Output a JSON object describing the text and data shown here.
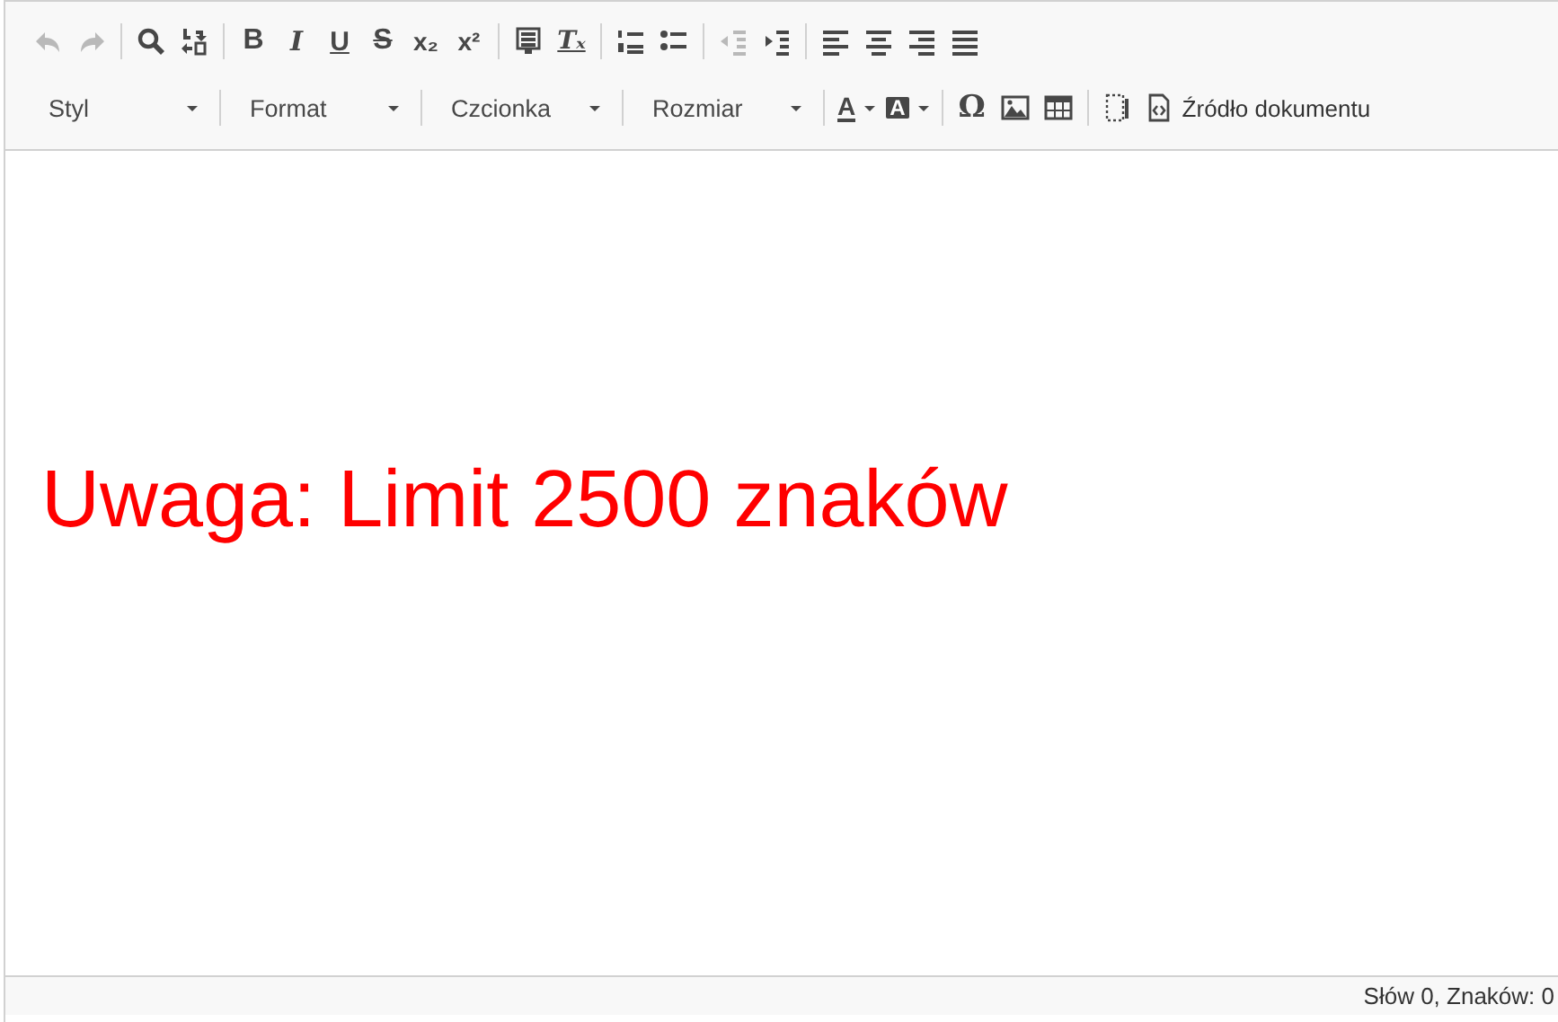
{
  "toolbar": {
    "rows": [
      [
        [
          {
            "kind": "undo",
            "disabled": true
          },
          {
            "kind": "redo",
            "disabled": true
          }
        ],
        [
          {
            "kind": "find",
            "disabled": false
          },
          {
            "kind": "replace",
            "disabled": false
          }
        ],
        [
          {
            "kind": "bold",
            "glyph": "B",
            "disabled": false
          },
          {
            "kind": "italic",
            "glyph": "I",
            "disabled": false
          },
          {
            "kind": "underline",
            "glyph": "U",
            "disabled": false
          },
          {
            "kind": "strike",
            "glyph": "S",
            "disabled": false
          },
          {
            "kind": "subscript",
            "glyph": "x₂",
            "disabled": false
          },
          {
            "kind": "superscript",
            "glyph": "x²",
            "disabled": false
          }
        ],
        [
          {
            "kind": "paste-text",
            "disabled": false
          },
          {
            "kind": "remove-format",
            "glyph": "Tₓ",
            "disabled": false
          }
        ],
        [
          {
            "kind": "numbered-list",
            "disabled": false
          },
          {
            "kind": "bulleted-list",
            "disabled": false
          }
        ],
        [
          {
            "kind": "outdent",
            "disabled": true
          },
          {
            "kind": "indent",
            "disabled": false
          }
        ],
        [
          {
            "kind": "align-left",
            "disabled": false
          },
          {
            "kind": "align-center",
            "disabled": false
          },
          {
            "kind": "align-right",
            "disabled": false
          },
          {
            "kind": "justify",
            "disabled": false
          }
        ]
      ],
      [
        [
          {
            "kind": "combo",
            "label": "Styl"
          }
        ],
        [
          {
            "kind": "combo",
            "label": "Format"
          }
        ],
        [
          {
            "kind": "combo",
            "label": "Czcionka"
          }
        ],
        [
          {
            "kind": "combo",
            "label": "Rozmiar"
          }
        ],
        [
          {
            "kind": "text-color",
            "glyph": "A",
            "disabled": false
          },
          {
            "kind": "bg-color",
            "glyph": "A",
            "disabled": false
          }
        ],
        [
          {
            "kind": "special-char",
            "glyph": "Ω",
            "disabled": false
          },
          {
            "kind": "image",
            "disabled": false
          },
          {
            "kind": "table",
            "disabled": false
          }
        ],
        [
          {
            "kind": "show-blocks",
            "disabled": false
          },
          {
            "kind": "source",
            "label": "Źródło dokumentu",
            "disabled": false
          }
        ]
      ]
    ]
  },
  "content": {
    "text": "Uwaga: Limit 2500 znaków",
    "color": "#ff0000"
  },
  "status_bar": {
    "text": "Słów 0, Znaków: 0"
  }
}
